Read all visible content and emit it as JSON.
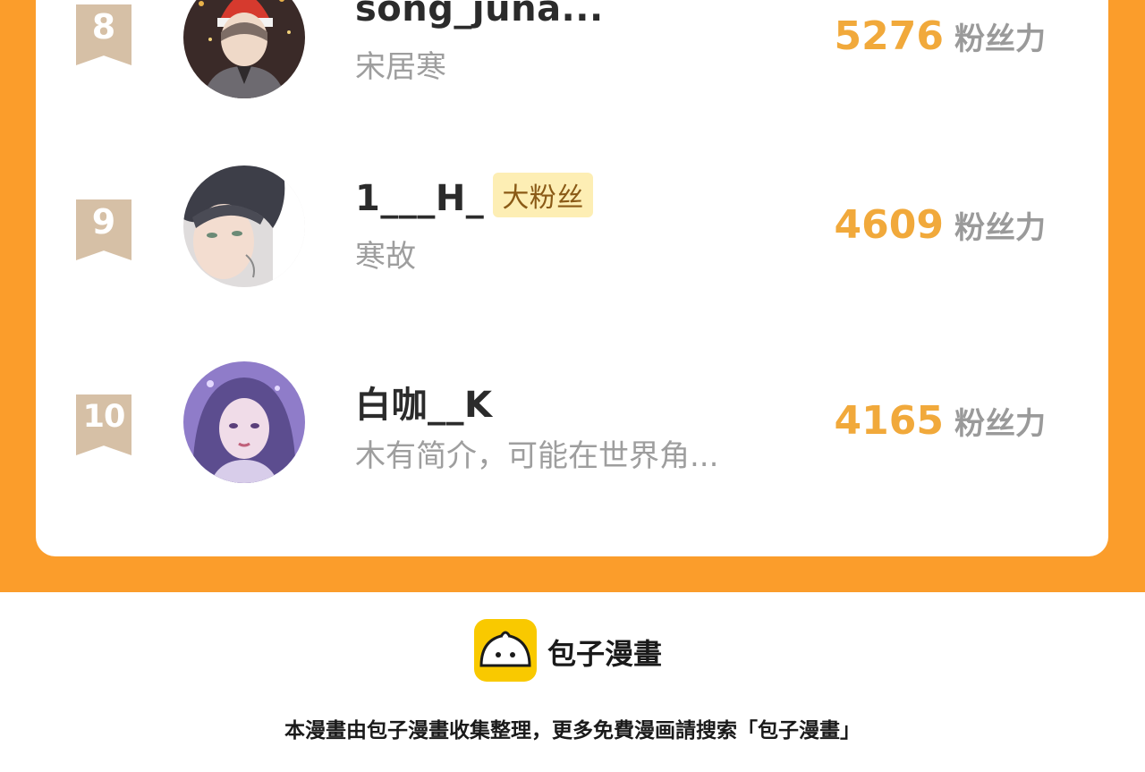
{
  "ranking": [
    {
      "rank": "8",
      "name": "song_juna...",
      "badge": "",
      "bio": "宋居寒",
      "score": "5276",
      "unit": "粉丝力",
      "avatar_icon": "user-avatar-red-hat"
    },
    {
      "rank": "9",
      "name": "1___H_",
      "badge": "大粉丝",
      "bio": "寒故",
      "score": "4609",
      "unit": "粉丝力",
      "avatar_icon": "user-avatar-dark-hair"
    },
    {
      "rank": "10",
      "name": "白咖__K",
      "badge": "",
      "bio": "木有简介，可能在世界角...",
      "score": "4165",
      "unit": "粉丝力",
      "avatar_icon": "user-avatar-purple"
    }
  ],
  "footer": {
    "brand": "包子漫畫",
    "note": "本漫畫由包子漫畫收集整理，更多免費漫画請搜索「包子漫畫」",
    "logo_icon": "baozi-bun-icon"
  },
  "colors": {
    "frame": "#fb9d2b",
    "score": "#f1a93b",
    "rank_ribbon": "#d6c0a6",
    "badge_bg": "#fdeeb4",
    "logo_bg": "#f9c900"
  }
}
